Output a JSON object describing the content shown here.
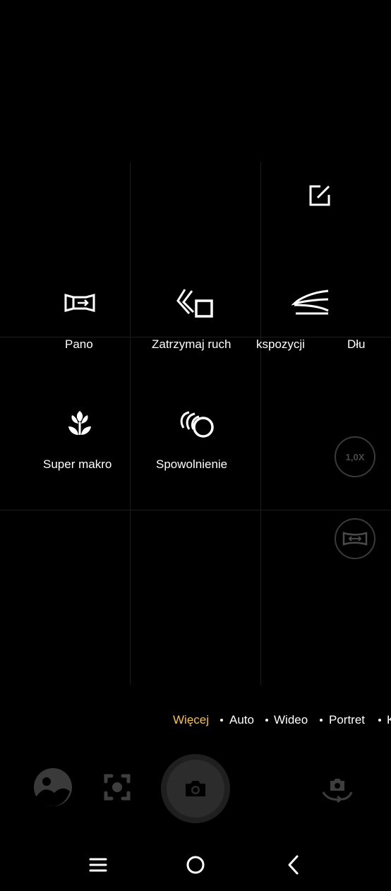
{
  "edit_button": {
    "icon": "edit-icon"
  },
  "modes": [
    {
      "label": "Pano",
      "icon": "pano-icon"
    },
    {
      "label": "Zatrzymaj ruch",
      "icon": "freeze-motion-icon"
    },
    {
      "label": "kspozycji",
      "icon": "long-exposure-icon"
    },
    {
      "label": "Dłu",
      "icon": ""
    },
    {
      "label": "Super makro",
      "icon": "flower-macro-icon"
    },
    {
      "label": "Spowolnienie",
      "icon": "slow-motion-icon"
    }
  ],
  "zoom": {
    "label": "1,0X"
  },
  "mode_tabs": [
    {
      "label": "Więcej",
      "active": true,
      "color": "#f2c14e"
    },
    {
      "label": "Auto",
      "active": false
    },
    {
      "label": "Wideo",
      "active": false
    },
    {
      "label": "Portret",
      "active": false
    },
    {
      "label": "K",
      "active": false
    }
  ],
  "bottom_controls": {
    "gallery_icon": "gallery-icon",
    "lens_icon": "lens-icon",
    "shutter_icon": "camera-icon",
    "switch_icon": "switch-camera-icon"
  },
  "nav": {
    "menu": "menu-icon",
    "home": "home-icon",
    "back": "back-icon"
  }
}
